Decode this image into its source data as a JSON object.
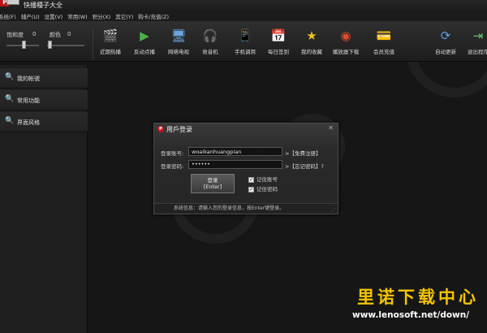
{
  "window": {
    "title": "快播種子大全",
    "logo_letter": "P"
  },
  "menu": [
    "系统(F)",
    "辅产(U)",
    "设置(V)",
    "常用(W)",
    "积分(X)",
    "其它(Y)",
    "购卡/充值(Z)"
  ],
  "adjust": {
    "saturation_label": "饱和度",
    "saturation_value": "0",
    "color_label": "颜色",
    "color_value": "0"
  },
  "toolbar": [
    {
      "label": "近期热播",
      "icon": "movie-icon",
      "glyph": "🎬"
    },
    {
      "label": "反动点播",
      "icon": "play-icon",
      "glyph": "▶"
    },
    {
      "label": "网络电视",
      "icon": "tv-icon",
      "glyph": "🖥"
    },
    {
      "label": "收音机",
      "icon": "headphones-icon",
      "glyph": "🎧"
    },
    {
      "label": "手机调用",
      "icon": "phone-icon",
      "glyph": "📱"
    },
    {
      "label": "每日签到",
      "icon": "calendar-icon",
      "glyph": "📅"
    },
    {
      "label": "我的收藏",
      "icon": "star-icon",
      "glyph": "★"
    },
    {
      "label": "播放器下载",
      "icon": "browser-icon",
      "glyph": "◉"
    },
    {
      "label": "会员充值",
      "icon": "wallet-icon",
      "glyph": "💳"
    },
    {
      "label": "自动更新",
      "icon": "update-icon",
      "glyph": "⟳"
    },
    {
      "label": "退出程序",
      "icon": "exit-icon",
      "glyph": "⇥"
    }
  ],
  "sidebar": [
    {
      "label": "我的帐號"
    },
    {
      "label": "常用功能"
    },
    {
      "label": "界面风格"
    }
  ],
  "dialog": {
    "title": "用戶登录",
    "account_label": "登录账号:",
    "account_value": "woaikanhuangpian",
    "password_label": "登录密码:",
    "password_value": "••••••",
    "register_link": ">【免費注册】",
    "forgot_link": ">【忘记密码】?",
    "login_line1": "登录",
    "login_line2": "[Enter]",
    "remember_account": "记住账号",
    "remember_password": "记住密码",
    "remember_account_checked": true,
    "remember_password_checked": true,
    "status": "系统信息：请输入您的登录信息，按Enter键登录。"
  },
  "watermark": {
    "title": "里诺下载中心",
    "url": "www.lenosoft.net/down/"
  },
  "colors": {
    "background": "#161616",
    "accent_red": "#c4161c",
    "watermark_yellow": "#f5c400"
  }
}
